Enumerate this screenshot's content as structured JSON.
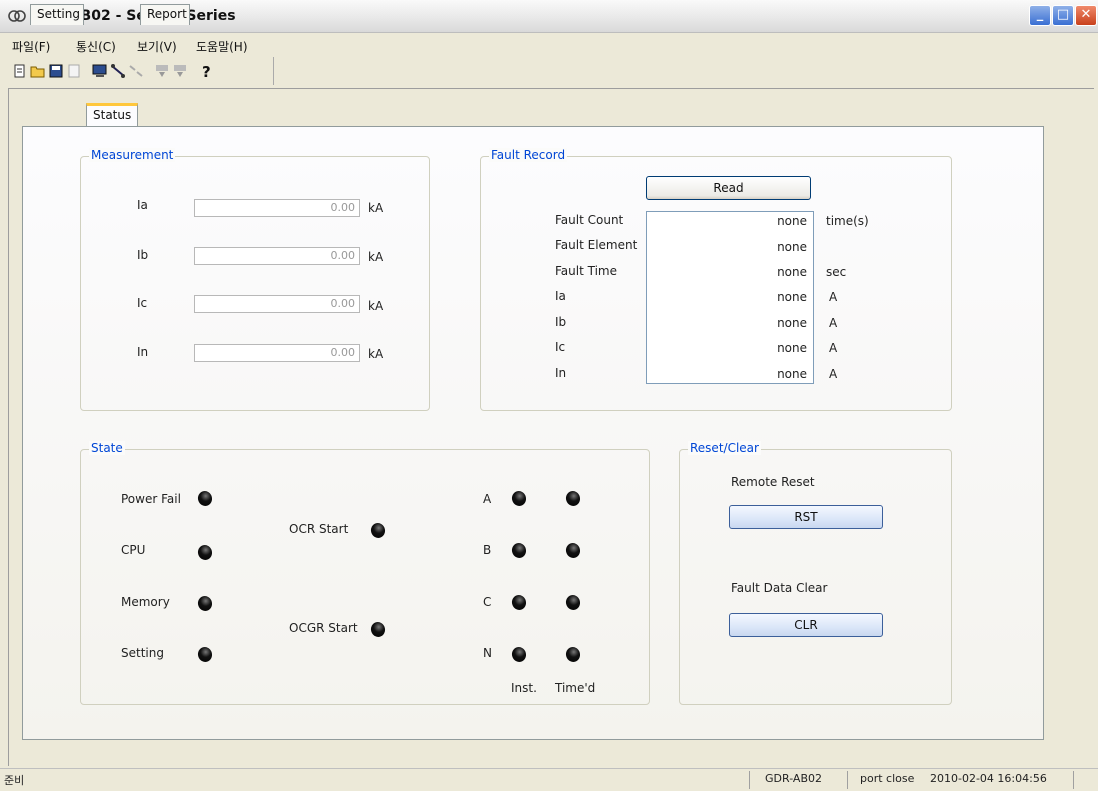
{
  "window": {
    "title": "GDR-AB02 - SetGDRSeries"
  },
  "menu": [
    "파일(F)",
    "통신(C)",
    "보기(V)",
    "도움말(H)"
  ],
  "toolbar_icons": [
    "new-icon",
    "open-icon",
    "save-icon",
    "document-icon",
    "computer-icon",
    "connect-icon",
    "disconnect-icon",
    "download-icon",
    "upload-icon",
    "help-icon"
  ],
  "tabs": [
    "Setting",
    "Status",
    "Report"
  ],
  "measurement": {
    "title": "Measurement",
    "rows": [
      {
        "label": "Ia",
        "value": "0.00",
        "unit": "kA"
      },
      {
        "label": "Ib",
        "value": "0.00",
        "unit": "kA"
      },
      {
        "label": "Ic",
        "value": "0.00",
        "unit": "kA"
      },
      {
        "label": "In",
        "value": "0.00",
        "unit": "kA"
      }
    ]
  },
  "fault_record": {
    "title": "Fault Record",
    "read_label": "Read",
    "rows": [
      {
        "label": "Fault Count",
        "value": "none",
        "unit": "time(s)"
      },
      {
        "label": "Fault Element",
        "value": "none",
        "unit": ""
      },
      {
        "label": "Fault Time",
        "value": "none",
        "unit": "sec"
      },
      {
        "label": "Ia",
        "value": "none",
        "unit": "A"
      },
      {
        "label": "Ib",
        "value": "none",
        "unit": "A"
      },
      {
        "label": "Ic",
        "value": "none",
        "unit": "A"
      },
      {
        "label": "In",
        "value": "none",
        "unit": "A"
      }
    ]
  },
  "state": {
    "title": "State",
    "system": [
      "Power Fail",
      "CPU",
      "Memory",
      "Setting"
    ],
    "start": [
      "OCR Start",
      "OCGR Start"
    ],
    "phases": [
      "A",
      "B",
      "C",
      "N"
    ],
    "col_inst": "Inst.",
    "col_timed": "Time'd"
  },
  "reset_clear": {
    "title": "Reset/Clear",
    "remote_reset_label": "Remote Reset",
    "rst_label": "RST",
    "fault_clear_label": "Fault Data Clear",
    "clr_label": "CLR"
  },
  "statusbar": {
    "ready": "준비",
    "device": "GDR-AB02",
    "port": "port close",
    "datetime": "2010-02-04 16:04:56"
  }
}
